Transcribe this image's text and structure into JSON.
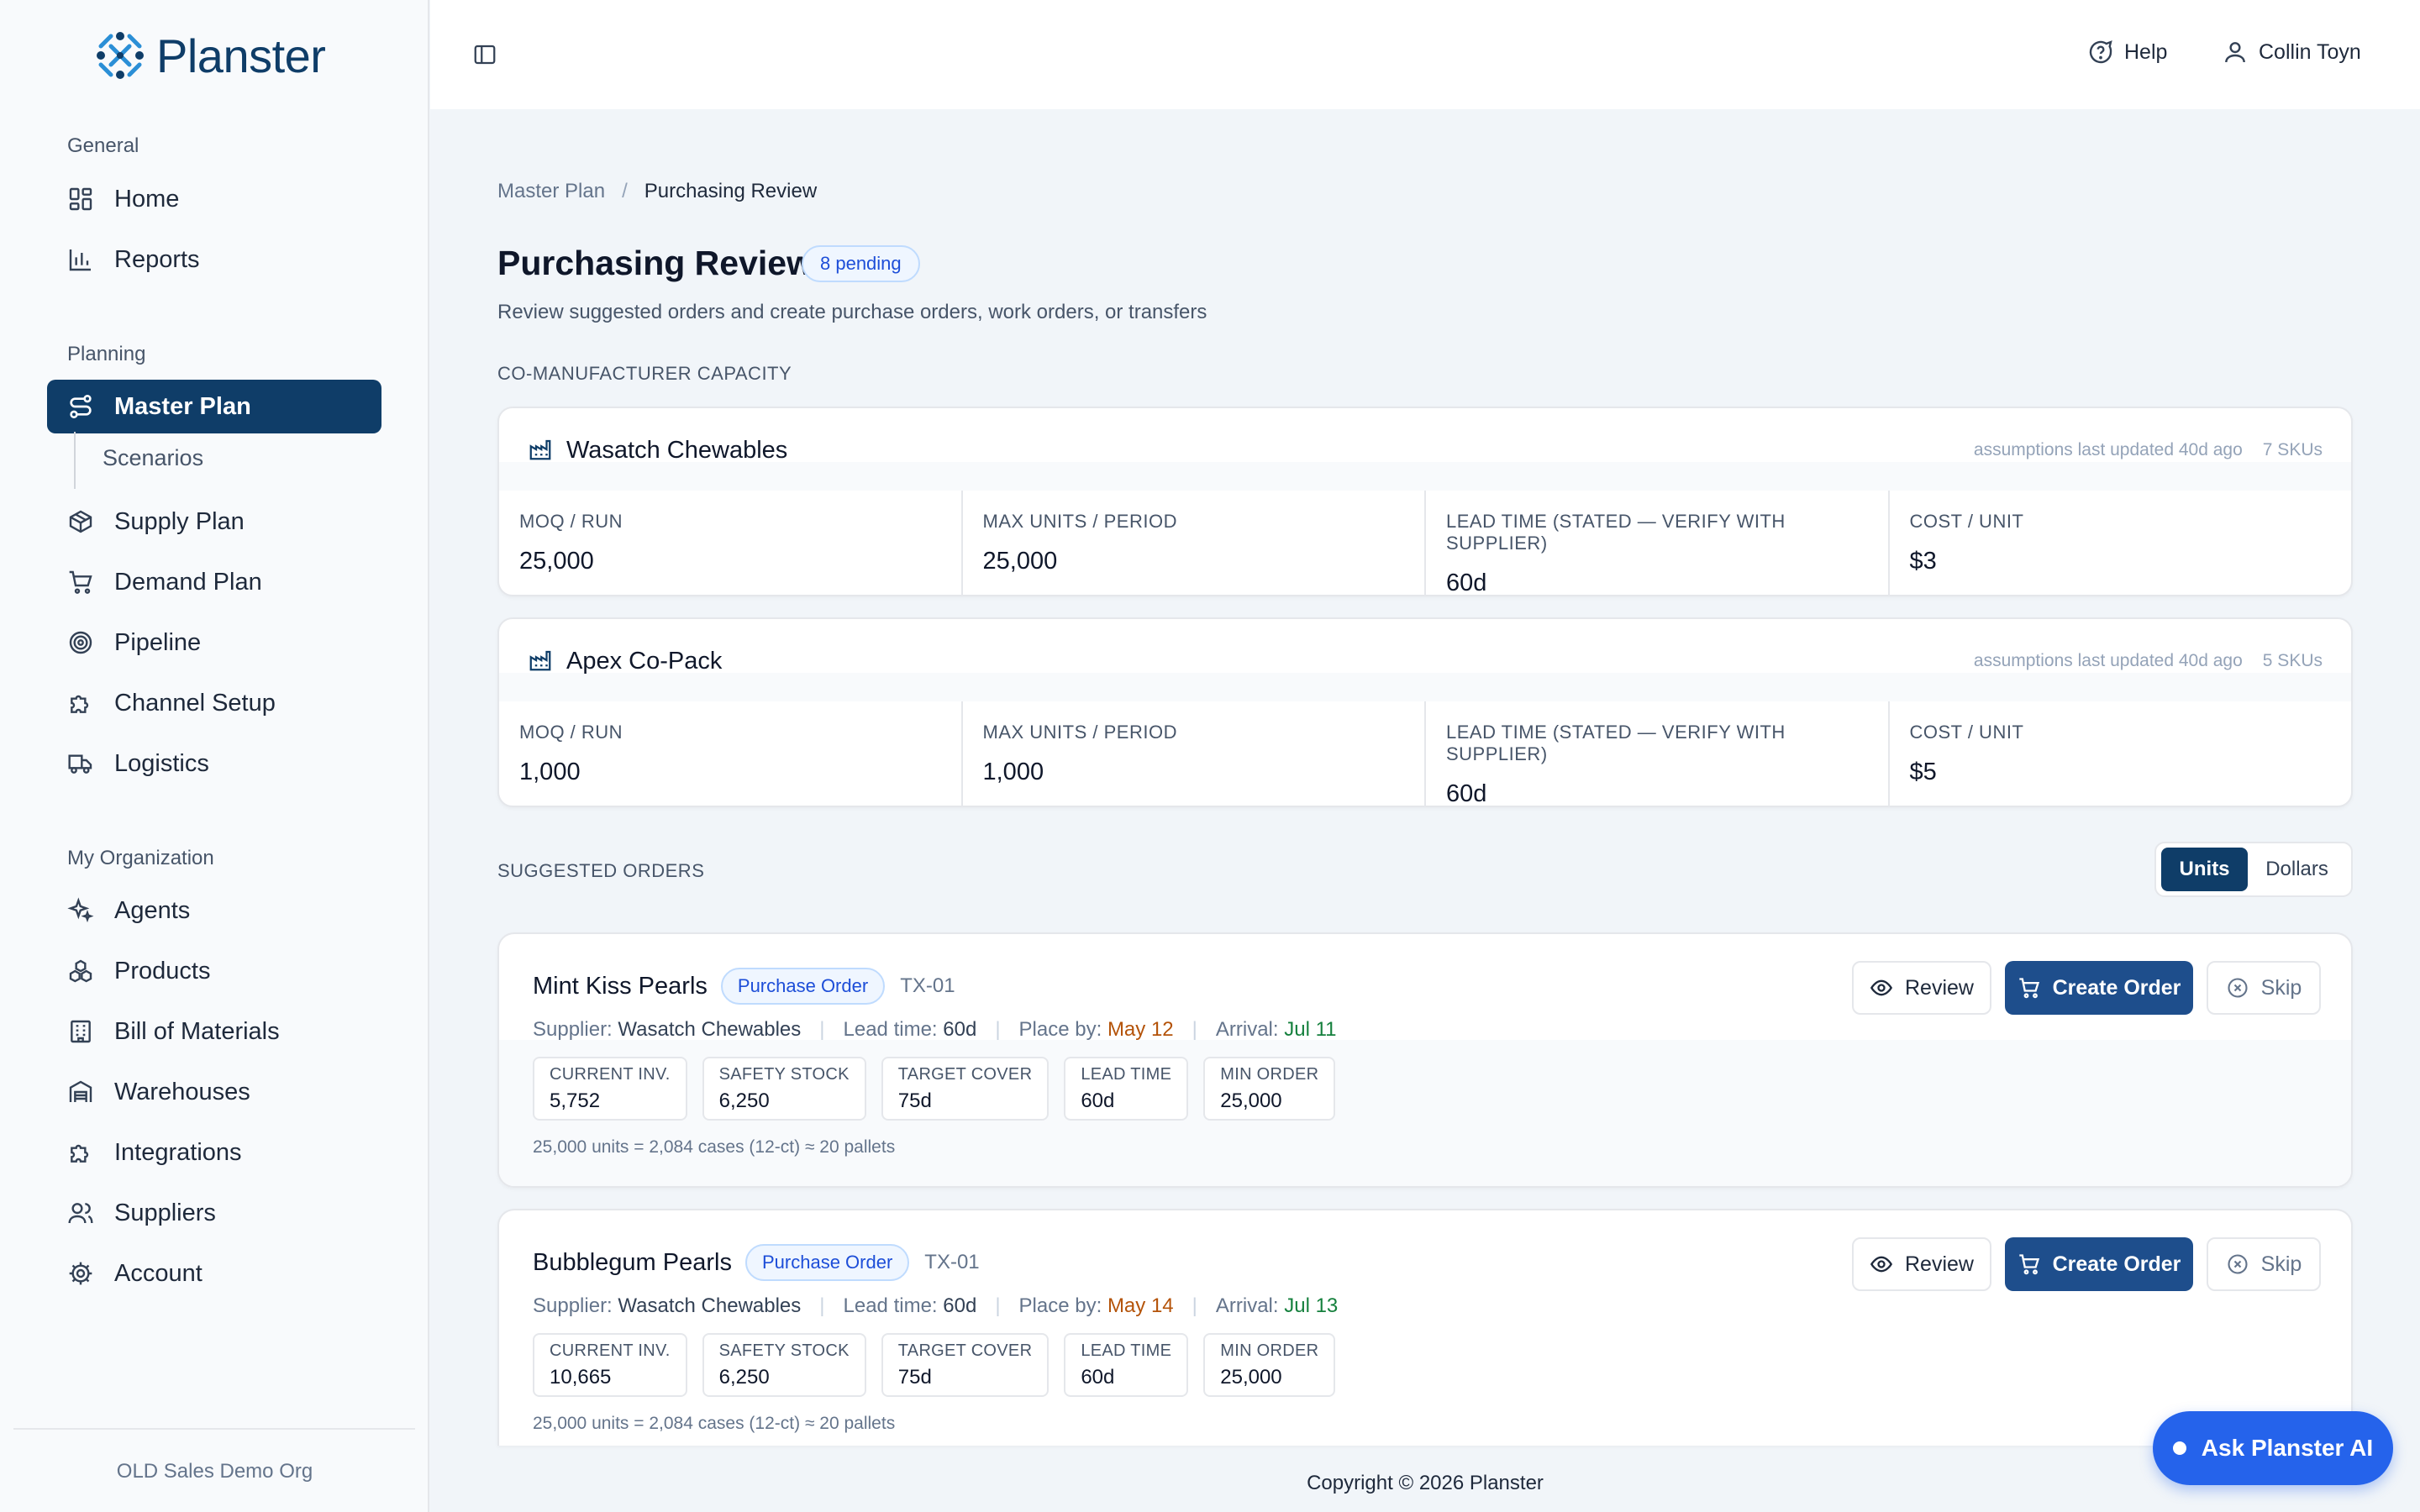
{
  "app": {
    "name": "Planster"
  },
  "sidebar": {
    "sections": {
      "general": "General",
      "planning": "Planning",
      "organization": "My Organization"
    },
    "items": {
      "home": "Home",
      "reports": "Reports",
      "master_plan": "Master Plan",
      "scenarios": "Scenarios",
      "supply_plan": "Supply Plan",
      "demand_plan": "Demand Plan",
      "pipeline": "Pipeline",
      "channel_setup": "Channel Setup",
      "logistics": "Logistics",
      "agents": "Agents",
      "products": "Products",
      "bom": "Bill of Materials",
      "warehouses": "Warehouses",
      "integrations": "Integrations",
      "suppliers": "Suppliers",
      "account": "Account"
    },
    "org_name": "OLD Sales Demo Org"
  },
  "header": {
    "help": "Help",
    "user": "Collin Toyn"
  },
  "breadcrumb": {
    "parent": "Master Plan",
    "separator": "/",
    "current": "Purchasing Review"
  },
  "page": {
    "title": "Purchasing Review",
    "pending_badge": "8 pending",
    "subtitle": "Review suggested orders and create purchase orders, work orders, or transfers"
  },
  "capacity": {
    "section_label": "CO-MANUFACTURER CAPACITY",
    "stat_labels": {
      "moq": "MOQ / RUN",
      "max_units": "MAX UNITS / PERIOD",
      "lead_time": "LEAD TIME (STATED — VERIFY WITH SUPPLIER)",
      "cost": "COST / UNIT"
    },
    "manufacturers": [
      {
        "name": "Wasatch Chewables",
        "updated": "assumptions last updated 40d ago",
        "skus": "7 SKUs",
        "moq": "25,000",
        "max_units": "25,000",
        "lead_time": "60d",
        "cost": "$3"
      },
      {
        "name": "Apex Co-Pack",
        "updated": "assumptions last updated 40d ago",
        "skus": "5 SKUs",
        "moq": "1,000",
        "max_units": "1,000",
        "lead_time": "60d",
        "cost": "$5"
      }
    ]
  },
  "orders": {
    "section_label": "SUGGESTED ORDERS",
    "toggle": {
      "units": "Units",
      "dollars": "Dollars",
      "selected": "Units"
    },
    "labels": {
      "supplier": "Supplier:",
      "lead_time": "Lead time:",
      "place_by": "Place by:",
      "arrival": "Arrival:",
      "current_inv": "CURRENT INV.",
      "safety_stock": "SAFETY STOCK",
      "target_cover": "TARGET COVER",
      "lead_time_chip": "LEAD TIME",
      "min_order": "MIN ORDER",
      "review": "Review",
      "create": "Create Order",
      "skip": "Skip"
    },
    "items": [
      {
        "name": "Mint Kiss Pearls",
        "type": "Purchase Order",
        "location": "TX-01",
        "supplier": "Wasatch Chewables",
        "lead_time": "60d",
        "place_by": "May 12",
        "arrival": "Jul 11",
        "current_inv": "5,752",
        "safety_stock": "6,250",
        "target_cover": "75d",
        "lead_time_chip": "60d",
        "min_order": "25,000",
        "footnote": "25,000 units = 2,084 cases (12-ct) ≈ 20 pallets"
      },
      {
        "name": "Bubblegum Pearls",
        "type": "Purchase Order",
        "location": "TX-01",
        "supplier": "Wasatch Chewables",
        "lead_time": "60d",
        "place_by": "May 14",
        "arrival": "Jul 13",
        "current_inv": "10,665",
        "safety_stock": "6,250",
        "target_cover": "75d",
        "lead_time_chip": "60d",
        "min_order": "25,000",
        "footnote": "25,000 units = 2,084 cases (12-ct) ≈ 20 pallets"
      }
    ]
  },
  "footer": {
    "copyright": "Copyright © 2026 Planster"
  },
  "assistant": {
    "label": "Ask Planster AI"
  },
  "colors": {
    "brand": "#0f3d68",
    "primary_button": "#1e4e8c",
    "assistant": "#2563eb",
    "warn": "#b45309",
    "ok": "#15803d",
    "badge": "#1d4ed8"
  }
}
